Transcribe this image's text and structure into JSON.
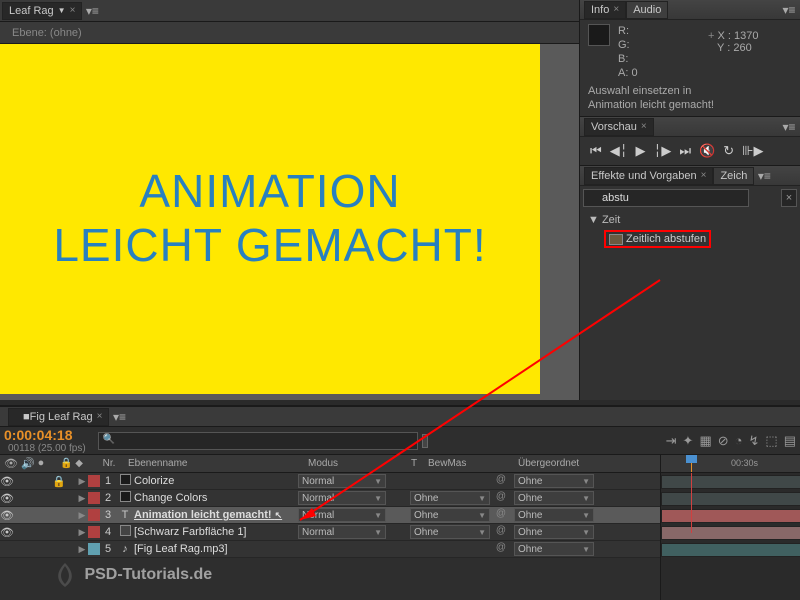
{
  "header": {
    "comp_tab": "Leaf Rag",
    "layer_label": "Ebene: (ohne)"
  },
  "canvas_text_line1": "ANIMATION",
  "canvas_text_line2": "LEICHT GEMACHT!",
  "info": {
    "tab1": "Info",
    "tab2": "Audio",
    "r_label": "R:",
    "g_label": "G:",
    "b_label": "B:",
    "a_label": "A:",
    "a_value": "0",
    "x_label": "X :",
    "x_value": "1370",
    "y_label": "Y :",
    "y_value": "260",
    "msg_line1": "Auswahl einsetzen in",
    "msg_line2": "Animation leicht gemacht!"
  },
  "preview": {
    "tab": "Vorschau"
  },
  "effects": {
    "tab": "Effekte und Vorgaben",
    "tab2": "Zeich",
    "search": "abstu",
    "group": "Zeit",
    "preset": "Zeitlich abstufen"
  },
  "timeline": {
    "tab": "Fig Leaf Rag",
    "timecode": "0:00:04:18",
    "fps": "00118 (25.00 fps)",
    "ruler_30s": "00:30s",
    "cols": {
      "nr": "Nr.",
      "name": "Ebenenname",
      "mode": "Modus",
      "t": "T",
      "trk": "BewMas",
      "parent": "Übergeordnet"
    },
    "mode_normal": "Normal",
    "trk_none": "Ohne",
    "parent_none": "Ohne",
    "layers": [
      {
        "nr": "1",
        "name": "Colorize",
        "color": "#b04040",
        "locked": true,
        "icon": "adj"
      },
      {
        "nr": "2",
        "name": "Change Colors",
        "color": "#b04040",
        "locked": false,
        "icon": "adj"
      },
      {
        "nr": "3",
        "name": "Animation leicht gemacht!",
        "color": "#b04040",
        "locked": false,
        "icon": "text",
        "selected": true
      },
      {
        "nr": "4",
        "name": "[Schwarz Farbfläche 1]",
        "color": "#b04040",
        "locked": false,
        "icon": "solid"
      },
      {
        "nr": "5",
        "name": "[Fig Leaf Rag.mp3]",
        "color": "#60a0b0",
        "locked": false,
        "icon": "audio"
      }
    ]
  },
  "watermark": "PSD-Tutorials.de"
}
